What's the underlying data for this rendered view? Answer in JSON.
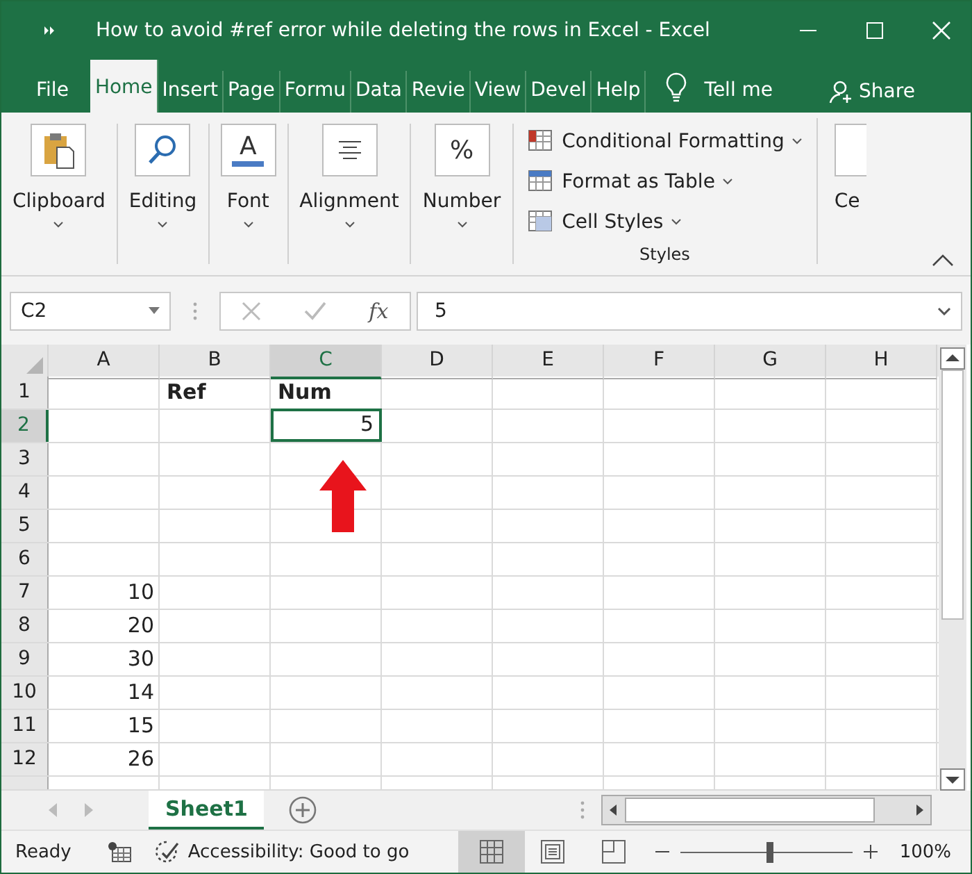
{
  "window": {
    "title": "How to avoid #ref error while deleting the rows in Excel  -  Excel"
  },
  "tabs": [
    {
      "label": "File",
      "selected": false
    },
    {
      "label": "Home",
      "selected": true
    },
    {
      "label": "Insert",
      "selected": false
    },
    {
      "label": "Page",
      "selected": false
    },
    {
      "label": "Formu",
      "selected": false
    },
    {
      "label": "Data",
      "selected": false
    },
    {
      "label": "Revie",
      "selected": false
    },
    {
      "label": "View",
      "selected": false
    },
    {
      "label": "Devel",
      "selected": false
    },
    {
      "label": "Help",
      "selected": false
    }
  ],
  "tell_me": "Tell me",
  "share": "Share",
  "ribbon": {
    "groups": [
      {
        "kind": "clipboard",
        "label": "Clipboard"
      },
      {
        "kind": "editing",
        "label": "Editing"
      },
      {
        "kind": "font",
        "label": "Font",
        "glyph": "A"
      },
      {
        "kind": "alignment",
        "label": "Alignment"
      },
      {
        "kind": "number",
        "label": "Number",
        "glyph": "%"
      }
    ],
    "styles": {
      "items": [
        {
          "kind": "conditional",
          "label": "Conditional Formatting"
        },
        {
          "kind": "table",
          "label": "Format as Table"
        },
        {
          "kind": "cellstyles",
          "label": "Cell Styles"
        }
      ],
      "label": "Styles"
    },
    "cut_group": "Ce"
  },
  "formula_bar": {
    "name_box": "C2",
    "fx": "fx",
    "value": "5"
  },
  "columns": [
    {
      "label": "A",
      "selected": false
    },
    {
      "label": "B",
      "selected": false
    },
    {
      "label": "C",
      "selected": true
    },
    {
      "label": "D",
      "selected": false
    },
    {
      "label": "E",
      "selected": false
    },
    {
      "label": "F",
      "selected": false
    },
    {
      "label": "G",
      "selected": false
    },
    {
      "label": "H",
      "selected": false
    }
  ],
  "rows": [
    {
      "number": "1",
      "selected": false,
      "cells": [
        {
          "selected": false
        },
        {
          "text": "Ref",
          "selected": false
        },
        {
          "text": "Num",
          "selected": false
        }
      ]
    },
    {
      "number": "2",
      "selected": true,
      "cells": [
        {
          "selected": false
        },
        {
          "selected": false
        },
        {
          "text": "5",
          "selected": true
        }
      ]
    },
    {
      "number": "3",
      "selected": false,
      "cells": [
        {
          "selected": false
        },
        {
          "selected": false
        },
        {
          "selected": false
        }
      ]
    },
    {
      "number": "4",
      "selected": false,
      "cells": [
        {
          "selected": false
        },
        {
          "selected": false
        },
        {
          "selected": false
        }
      ]
    },
    {
      "number": "5",
      "selected": false,
      "cells": [
        {
          "selected": false
        },
        {
          "selected": false
        },
        {
          "selected": false
        }
      ]
    },
    {
      "number": "6",
      "selected": false,
      "cells": [
        {
          "selected": false
        },
        {
          "selected": false
        },
        {
          "selected": false
        }
      ]
    },
    {
      "number": "7",
      "selected": false,
      "cells": [
        {
          "text": "10",
          "selected": false
        },
        {
          "selected": false
        },
        {
          "selected": false
        }
      ]
    },
    {
      "number": "8",
      "selected": false,
      "cells": [
        {
          "text": "20",
          "selected": false
        },
        {
          "selected": false
        },
        {
          "selected": false
        }
      ]
    },
    {
      "number": "9",
      "selected": false,
      "cells": [
        {
          "text": "30",
          "selected": false
        },
        {
          "selected": false
        },
        {
          "selected": false
        }
      ]
    },
    {
      "number": "10",
      "selected": false,
      "cells": [
        {
          "text": "14",
          "selected": false
        },
        {
          "selected": false
        },
        {
          "selected": false
        }
      ]
    },
    {
      "number": "11",
      "selected": false,
      "cells": [
        {
          "text": "15",
          "selected": false
        },
        {
          "selected": false
        },
        {
          "selected": false
        }
      ]
    },
    {
      "number": "12",
      "selected": false,
      "cells": [
        {
          "text": "26",
          "selected": false
        },
        {
          "selected": false
        },
        {
          "selected": false
        }
      ]
    }
  ],
  "sheets": [
    {
      "label": "Sheet1",
      "selected": true
    }
  ],
  "status_bar": {
    "status": "Ready",
    "accessibility": "Accessibility: Good to go",
    "zoom": "100%",
    "level": 0.52
  }
}
